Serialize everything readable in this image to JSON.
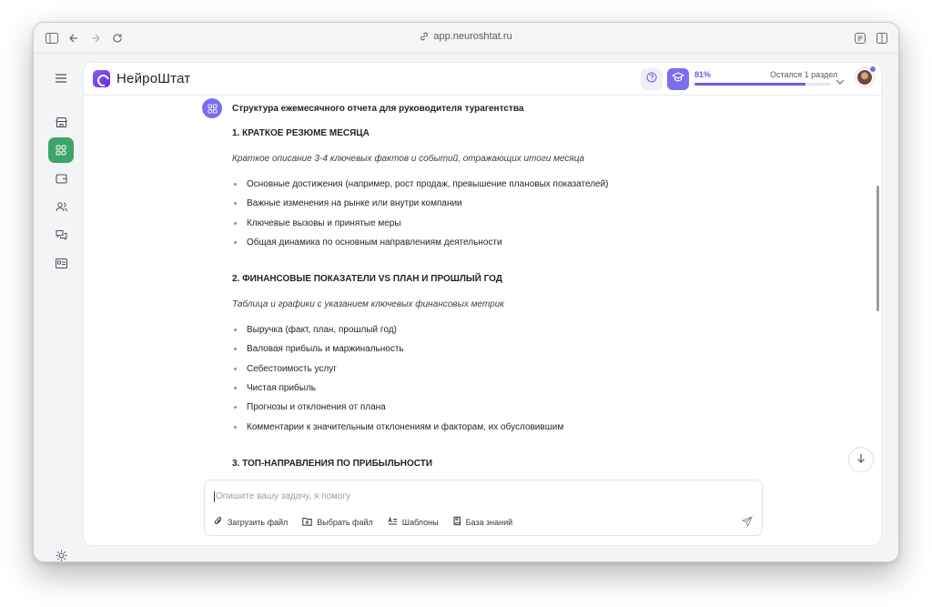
{
  "browser": {
    "url": "app.neuroshtat.ru"
  },
  "icons": {
    "sidebar_toggle": "sidebar-toggle-icon",
    "back": "arrow-left-icon",
    "forward": "arrow-right-icon",
    "reload": "reload-icon",
    "reader": "reader-icon",
    "split": "split-view-icon"
  },
  "app": {
    "brand": "НейроШтат",
    "progress_percent": "81%",
    "progress_fraction": 0.81,
    "progress_remaining": "Остался 1 раздел",
    "accent_color": "#6d5ce8",
    "active_nav_color": "#3fa46a"
  },
  "document": {
    "title": "Структура ежемесячного отчета для руководителя турагентства",
    "sections": [
      {
        "heading": "1. КРАТКОЕ РЕЗЮМЕ МЕСЯЦА",
        "subtitle": "Краткое описание 3-4 ключевых фактов и событий, отражающих итоги месяца",
        "items": [
          "Основные достижения (например, рост продаж, превышение плановых показателей)",
          "Важные изменения на рынке или внутри компании",
          "Ключевые вызовы и принятые меры",
          "Общая динамика по основным направлениям деятельности"
        ]
      },
      {
        "heading": "2. ФИНАНСОВЫЕ ПОКАЗАТЕЛИ VS ПЛАН И ПРОШЛЫЙ ГОД",
        "subtitle": "Таблица и графики с указанием ключевых финансовых метрик",
        "items": [
          "Выручка (факт, план, прошлый год)",
          "Валовая прибыль и маржинальность",
          "Себестоимость услуг",
          "Чистая прибыль",
          "Прогнозы и отклонения от плана",
          "Комментарии к значительным отклонениям и факторам, их обусловившим"
        ]
      },
      {
        "heading": "3. ТОП-НАПРАВЛЕНИЯ ПО ПРИБЫЛЬНОСТИ"
      }
    ]
  },
  "composer": {
    "placeholder": "Опишите вашу задачу, я помогу",
    "upload_file": "Загрузить файл",
    "choose_file": "Выбрать файл",
    "templates": "Шаблоны",
    "knowledge_base": "База знаний"
  }
}
